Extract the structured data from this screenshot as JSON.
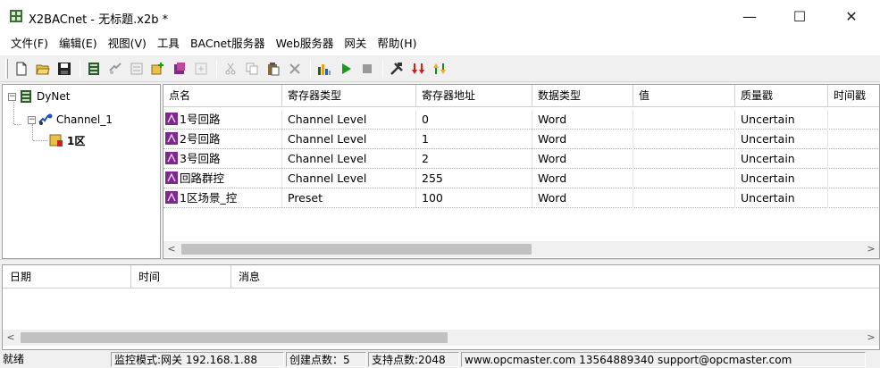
{
  "window": {
    "title": "X2BACnet - 无标题.x2b *",
    "minimize": "—",
    "maximize": "☐",
    "close": "✕"
  },
  "menu": [
    "文件(F)",
    "编辑(E)",
    "视图(V)",
    "工具",
    "BACnet服务器",
    "Web服务器",
    "网关",
    "帮助(H)"
  ],
  "toolbar": {
    "icons": [
      "new-file-icon",
      "open-folder-icon",
      "save-icon",
      "device-icon",
      "channel-icon",
      "group-icon",
      "add-point-icon",
      "import-icon",
      "export-icon",
      "cut-icon",
      "copy-icon",
      "paste-icon",
      "delete-icon",
      "monitor-icon",
      "run-icon",
      "stop-icon",
      "tools-icon",
      "load-icon",
      "connect-icon"
    ]
  },
  "tree": {
    "root": "DyNet",
    "channel": "Channel_1",
    "area": "1区"
  },
  "grid": {
    "columns": [
      "点名",
      "寄存器类型",
      "寄存器地址",
      "数据类型",
      "值",
      "质量戳",
      "时间戳"
    ],
    "rows": [
      {
        "name": "1号回路",
        "reg_type": "Channel Level",
        "address": "0",
        "data_type": "Word",
        "value": "",
        "quality": "Uncertain",
        "timestamp": ""
      },
      {
        "name": "2号回路",
        "reg_type": "Channel Level",
        "address": "1",
        "data_type": "Word",
        "value": "",
        "quality": "Uncertain",
        "timestamp": ""
      },
      {
        "name": "3号回路",
        "reg_type": "Channel Level",
        "address": "2",
        "data_type": "Word",
        "value": "",
        "quality": "Uncertain",
        "timestamp": ""
      },
      {
        "name": "回路群控",
        "reg_type": "Channel Level",
        "address": "255",
        "data_type": "Word",
        "value": "",
        "quality": "Uncertain",
        "timestamp": ""
      },
      {
        "name": "1区场景_控",
        "reg_type": "Preset",
        "address": "100",
        "data_type": "Word",
        "value": "",
        "quality": "Uncertain",
        "timestamp": ""
      }
    ]
  },
  "log": {
    "columns": [
      "日期",
      "时间",
      "消息"
    ]
  },
  "status": {
    "ready": "就绪",
    "mode": "监控模式:网关 192.168.1.88",
    "created": "创建点数：5",
    "supported": "支持点数:2048",
    "contact": "www.opcmaster.com 13564889340 support@opcmaster.com"
  },
  "colors": {
    "accent_point_icon": "#7a2a8c",
    "run_green": "#1a9a1a",
    "stop_gray": "#9a9a9a"
  }
}
